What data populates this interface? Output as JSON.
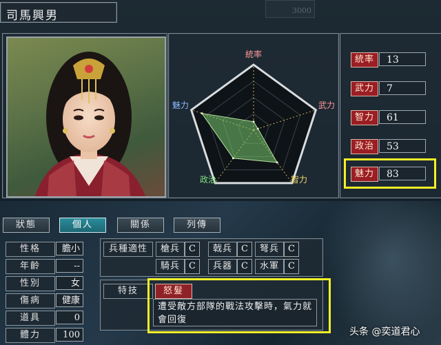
{
  "character": {
    "name": "司馬興男"
  },
  "top_deco_number": "3000",
  "radar": {
    "labels": [
      "統率",
      "武力",
      "智力",
      "政治",
      "魅力"
    ],
    "colors": [
      "#ff9a9a",
      "#ff9a9a",
      "#f2d86a",
      "#7ee07e",
      "#8fb8ff"
    ]
  },
  "stats": [
    {
      "label": "統率",
      "value": "13"
    },
    {
      "label": "武力",
      "value": "7"
    },
    {
      "label": "智力",
      "value": "61"
    },
    {
      "label": "政治",
      "value": "53"
    },
    {
      "label": "魅力",
      "value": "83"
    }
  ],
  "tabs": [
    {
      "label": "狀態",
      "active": false
    },
    {
      "label": "個人",
      "active": true
    },
    {
      "label": "關係",
      "active": false
    },
    {
      "label": "列傳",
      "active": false
    }
  ],
  "info": [
    {
      "label": "性格",
      "value": "膽小"
    },
    {
      "label": "年齡",
      "value": "--"
    },
    {
      "label": "性別",
      "value": "女"
    },
    {
      "label": "傷病",
      "value": "健康"
    },
    {
      "label": "道具",
      "value": "0"
    },
    {
      "label": "體力",
      "value": "100"
    }
  ],
  "aptitude": {
    "heading": "兵種適性",
    "items": [
      {
        "name": "槍兵",
        "grade": "C"
      },
      {
        "name": "戟兵",
        "grade": "C"
      },
      {
        "name": "弩兵",
        "grade": "C"
      },
      {
        "name": "騎兵",
        "grade": "C"
      },
      {
        "name": "兵器",
        "grade": "C"
      },
      {
        "name": "水軍",
        "grade": "C"
      }
    ]
  },
  "skill": {
    "heading": "特技",
    "name": "怒髮",
    "description": "遭受敵方部隊的戰法攻擊時，氣力就會回復"
  },
  "watermark": "头条 @奕道君心",
  "highlight_color": "#f4f028"
}
